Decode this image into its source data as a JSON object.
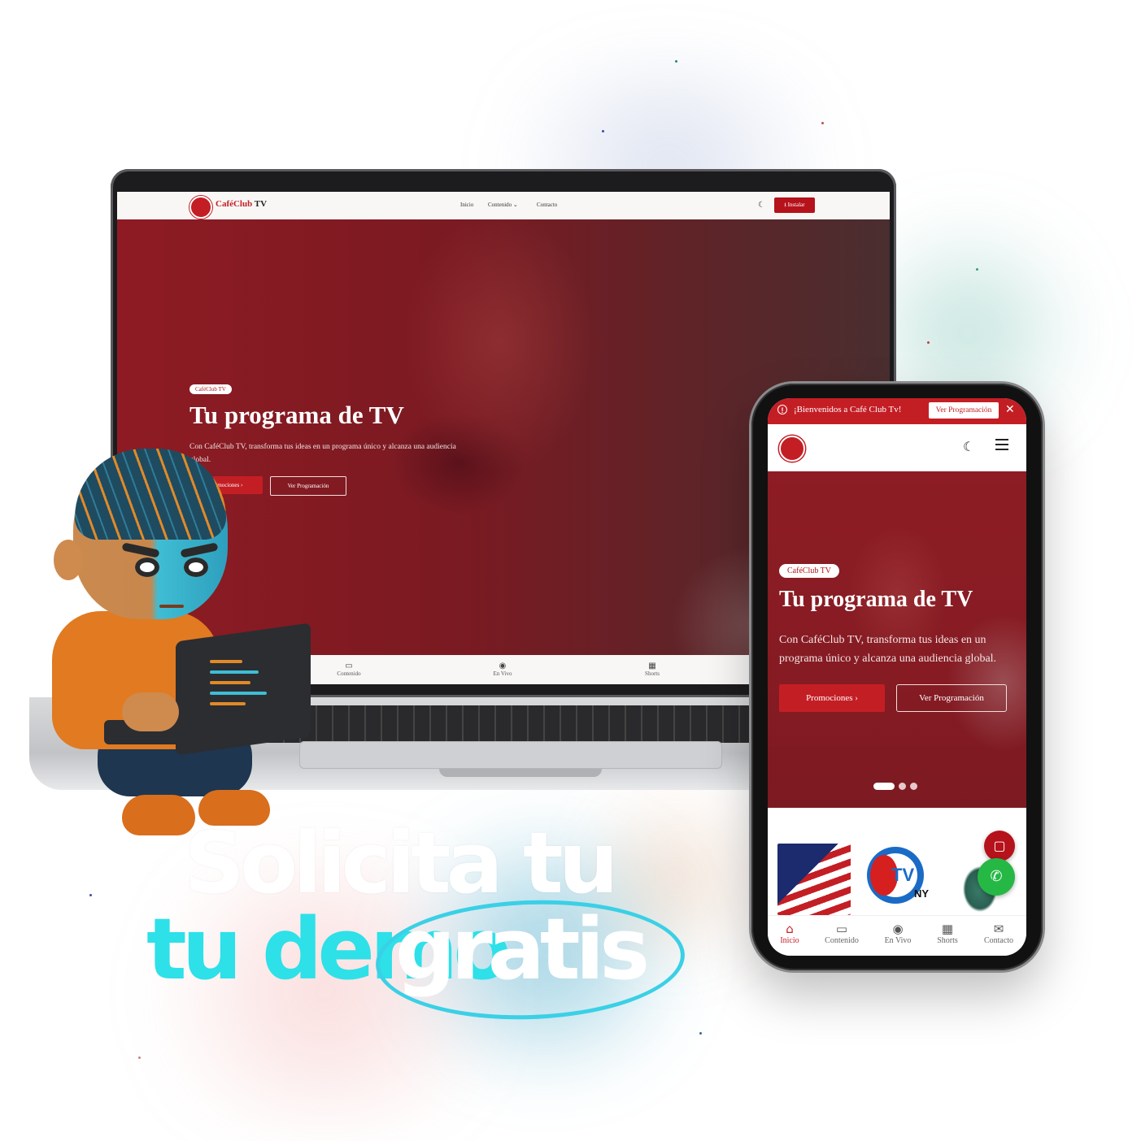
{
  "laptop_site": {
    "brand": {
      "prefix": "CaféClub",
      "suffix": "TV"
    },
    "nav": [
      {
        "label": "Inicio"
      },
      {
        "label": "Contenido"
      },
      {
        "label": "Contacto"
      }
    ],
    "install_label": "Instalar",
    "hero": {
      "badge": "CaféClub TV",
      "title": "Tu programa de TV",
      "subtitle": "Con CaféClub TV, transforma tus ideas en un programa único y alcanza una audiencia global.",
      "primary_button": "Promociones",
      "secondary_button": "Ver Programación"
    },
    "bottom_nav": [
      {
        "label": "Contenido",
        "icon": "tv-icon"
      },
      {
        "label": "En Vivo",
        "icon": "broadcast-icon"
      },
      {
        "label": "Shorts",
        "icon": "film-icon"
      }
    ]
  },
  "phone_site": {
    "notice": {
      "text": "¡Bienvenidos a Café Club Tv!",
      "button": "Ver Programación"
    },
    "hero": {
      "badge": "CaféClub TV",
      "title": "Tu programa de TV",
      "subtitle": "Con CaféClub TV, transforma tus ideas en un programa único y alcanza una audiencia global.",
      "primary_button": "Promociones",
      "secondary_button": "Ver Programación"
    },
    "carousel": {
      "slides": 3,
      "active": 1
    },
    "partner_logo": {
      "tv": "TV",
      "ny": "NY"
    },
    "bottom_nav": [
      {
        "label": "Inicio",
        "icon": "home-icon",
        "active": true
      },
      {
        "label": "Contenido",
        "icon": "tv-icon"
      },
      {
        "label": "En Vivo",
        "icon": "broadcast-icon"
      },
      {
        "label": "Shorts",
        "icon": "film-icon"
      },
      {
        "label": "Contacto",
        "icon": "mail-icon"
      }
    ]
  },
  "headline": {
    "line1": "Solicita tu",
    "line2a": "tu",
    "line2b": "demo",
    "line2c": "gratis"
  },
  "colors": {
    "brand_red": "#c41e25",
    "accent_cyan": "#2ee0e8",
    "whatsapp_green": "#25b845"
  }
}
